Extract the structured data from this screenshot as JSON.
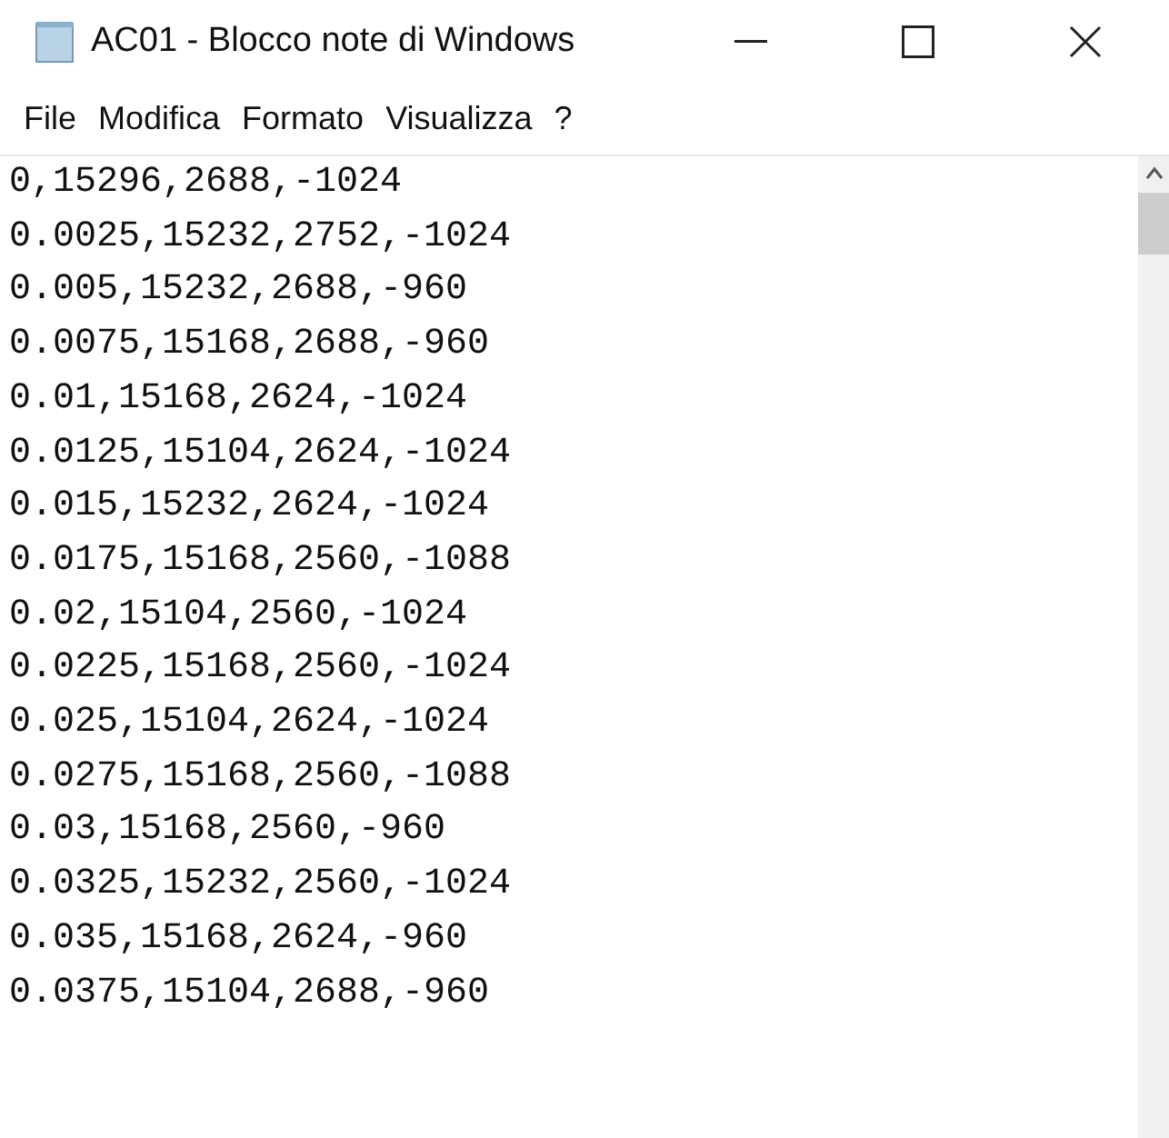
{
  "window": {
    "title": "AC01 - Blocco note di Windows"
  },
  "menu": [
    "File",
    "Modifica",
    "Formato",
    "Visualizza",
    "?"
  ],
  "lines": [
    "0,15296,2688,-1024",
    "0.0025,15232,2752,-1024",
    "0.005,15232,2688,-960",
    "0.0075,15168,2688,-960",
    "0.01,15168,2624,-1024",
    "0.0125,15104,2624,-1024",
    "0.015,15232,2624,-1024",
    "0.0175,15168,2560,-1088",
    "0.02,15104,2560,-1024",
    "0.0225,15168,2560,-1024",
    "0.025,15104,2624,-1024",
    "0.0275,15168,2560,-1088",
    "0.03,15168,2560,-960",
    "0.0325,15232,2560,-1024",
    "0.035,15168,2624,-960",
    "0.0375,15104,2688,-960"
  ]
}
